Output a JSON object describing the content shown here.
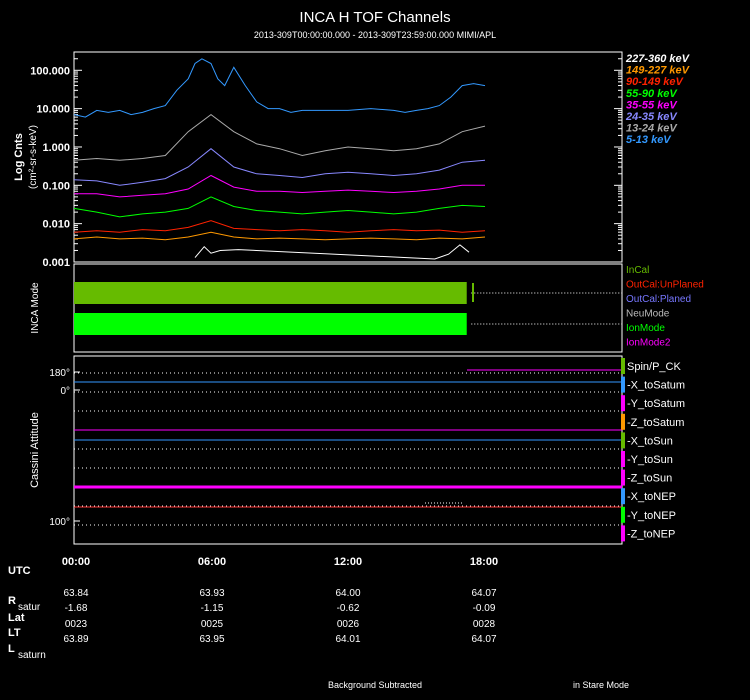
{
  "header": {
    "title": "INCA H TOF Channels",
    "subtitle": "2013-309T00:00:00.000 - 2013-309T23:59:00.000 MIMI/APL"
  },
  "footer": {
    "left": "Background Subtracted",
    "right": "in Stare Mode"
  },
  "ephemeris": {
    "label_utc": "UTC",
    "times": [
      "00:00",
      "06:00",
      "12:00",
      "18:00"
    ],
    "rows": [
      {
        "label": "R",
        "sub": "satur",
        "values": [
          "63.84",
          "63.93",
          "64.00",
          "64.07"
        ]
      },
      {
        "label": "Lat",
        "sub": "",
        "values": [
          "-1.68",
          "-1.15",
          "-0.62",
          "-0.09"
        ]
      },
      {
        "label": "LT",
        "sub": "",
        "values": [
          "0023",
          "0025",
          "0026",
          "0028"
        ]
      },
      {
        "label": "L",
        "sub": "saturn",
        "values": [
          "63.89",
          "63.95",
          "64.01",
          "64.07"
        ]
      }
    ]
  },
  "colors": {
    "axis": "#ffffff",
    "grid": "#ffffff"
  },
  "chart_data": [
    {
      "type": "line",
      "panel": "tof",
      "ylabel": "Log Cnts",
      "ylabel2": "(cm²-sr-s-keV)",
      "yscale": "log",
      "ylim": [
        0.001,
        300
      ],
      "xlim": [
        0,
        24
      ],
      "yticks": [
        "100.000",
        "10.000",
        "1.000",
        "0.100",
        "0.010",
        "0.001"
      ],
      "xticks": [
        0,
        6,
        12,
        18
      ],
      "legend_position": "right",
      "series": [
        {
          "name": "227-360 keV",
          "color": "#ffffff",
          "x": [
            5.3,
            5.7,
            6.0,
            6.4,
            7.2,
            15.8,
            16.4,
            16.9,
            17.3
          ],
          "y": [
            0.0013,
            0.0025,
            0.0017,
            0.002,
            0.0021,
            0.0012,
            0.0016,
            0.0028,
            0.0018
          ]
        },
        {
          "name": "149-227 keV",
          "color": "#ff9900",
          "x": [
            0,
            1,
            2,
            3,
            4,
            5,
            6,
            7,
            8,
            9,
            10,
            11,
            12,
            13,
            14,
            15,
            16,
            17,
            18
          ],
          "y": [
            0.004,
            0.0045,
            0.004,
            0.0042,
            0.0038,
            0.0045,
            0.006,
            0.0045,
            0.004,
            0.0042,
            0.004,
            0.0038,
            0.004,
            0.0042,
            0.004,
            0.0038,
            0.0042,
            0.004,
            0.0045
          ]
        },
        {
          "name": "90-149 keV",
          "color": "#ff2200",
          "x": [
            0,
            1,
            2,
            3,
            4,
            5,
            6,
            7,
            8,
            9,
            10,
            11,
            12,
            13,
            14,
            15,
            16,
            17,
            18
          ],
          "y": [
            0.006,
            0.0065,
            0.006,
            0.007,
            0.0065,
            0.008,
            0.012,
            0.0075,
            0.007,
            0.0065,
            0.007,
            0.0065,
            0.006,
            0.0065,
            0.007,
            0.0065,
            0.0068,
            0.006,
            0.0065
          ]
        },
        {
          "name": "55-90 keV",
          "color": "#00ff00",
          "x": [
            0,
            1,
            2,
            3,
            4,
            5,
            6,
            7,
            8,
            9,
            10,
            11,
            12,
            13,
            14,
            15,
            16,
            17,
            18
          ],
          "y": [
            0.025,
            0.02,
            0.015,
            0.018,
            0.02,
            0.025,
            0.05,
            0.028,
            0.022,
            0.02,
            0.018,
            0.02,
            0.022,
            0.02,
            0.018,
            0.02,
            0.025,
            0.03,
            0.028
          ]
        },
        {
          "name": "35-55 keV",
          "color": "#ff00ff",
          "x": [
            0,
            1,
            2,
            3,
            4,
            5,
            6,
            7,
            8,
            9,
            10,
            11,
            12,
            13,
            14,
            15,
            16,
            17,
            18
          ],
          "y": [
            0.06,
            0.06,
            0.05,
            0.055,
            0.06,
            0.08,
            0.18,
            0.09,
            0.07,
            0.07,
            0.065,
            0.07,
            0.075,
            0.07,
            0.065,
            0.07,
            0.08,
            0.1,
            0.1
          ]
        },
        {
          "name": "24-35 keV",
          "color": "#8888ff",
          "x": [
            0,
            1,
            2,
            3,
            4,
            5,
            6,
            7,
            8,
            9,
            10,
            11,
            12,
            13,
            14,
            15,
            16,
            17,
            18
          ],
          "y": [
            0.14,
            0.13,
            0.1,
            0.12,
            0.15,
            0.3,
            0.9,
            0.3,
            0.2,
            0.18,
            0.16,
            0.2,
            0.22,
            0.2,
            0.18,
            0.2,
            0.25,
            0.4,
            0.45
          ]
        },
        {
          "name": "13-24 keV",
          "color": "#aaaaaa",
          "x": [
            0,
            1,
            2,
            3,
            4,
            5,
            6,
            7,
            8,
            9,
            10,
            11,
            12,
            13,
            14,
            15,
            16,
            17,
            18
          ],
          "y": [
            0.45,
            0.5,
            0.45,
            0.5,
            0.6,
            2.5,
            7,
            2.5,
            1.2,
            0.9,
            0.6,
            0.8,
            1.0,
            0.9,
            0.8,
            0.9,
            1.2,
            2.5,
            3.5
          ]
        },
        {
          "name": "5-13 keV",
          "color": "#3399ff",
          "x": [
            0,
            0.5,
            1,
            1.5,
            2,
            2.5,
            3,
            3.5,
            4,
            4.5,
            5,
            5.3,
            5.6,
            6,
            6.3,
            6.6,
            7,
            7.5,
            8,
            8.5,
            9,
            9.5,
            10,
            11,
            12,
            13,
            14,
            14.5,
            15,
            15.5,
            16,
            16.5,
            17,
            17.5,
            18
          ],
          "y": [
            7,
            6,
            9,
            8,
            9,
            7,
            8,
            10,
            12,
            30,
            60,
            150,
            200,
            150,
            60,
            40,
            120,
            40,
            15,
            10,
            10,
            8,
            9,
            9,
            9,
            10,
            9,
            8,
            9,
            10,
            12,
            20,
            40,
            45,
            40
          ]
        }
      ]
    },
    {
      "type": "bar",
      "panel": "inca-mode",
      "ylabel": "INCA Mode",
      "xlim": [
        0,
        24
      ],
      "legend_position": "right",
      "legend": [
        {
          "name": "InCal",
          "color": "#66bb00"
        },
        {
          "name": "OutCal:UnPlaned",
          "color": "#ff2200"
        },
        {
          "name": "OutCal:Planed",
          "color": "#7777ff"
        },
        {
          "name": "NeuMode",
          "color": "#bbbbbb"
        },
        {
          "name": "IonMode",
          "color": "#00ff00"
        },
        {
          "name": "IonMode2",
          "color": "#ff00ff"
        }
      ],
      "bars": [
        {
          "mode": "InCal",
          "color": "#66bb00",
          "start": 0,
          "end": 17.2,
          "level": "upper"
        },
        {
          "mode": "IonMode",
          "color": "#00ff00",
          "start": 0,
          "end": 17.2,
          "level": "lower"
        }
      ]
    },
    {
      "type": "line",
      "panel": "cassini-attitude",
      "ylabel": "Cassini Attitude",
      "xlim": [
        0,
        24
      ],
      "yticks": [
        "180°",
        "0°",
        "100°"
      ],
      "legend_position": "right",
      "series": [
        {
          "name": "Spin/P_CK",
          "color": "#ffffff"
        },
        {
          "name": "-X_toSatum",
          "color": "#3399ff"
        },
        {
          "name": "-Y_toSatum",
          "color": "#ffffff"
        },
        {
          "name": "-Z_toSatum",
          "color": "#ff00ff"
        },
        {
          "name": "-X_toSun",
          "color": "#3399ff"
        },
        {
          "name": "-Y_toSun",
          "color": "#ffffff"
        },
        {
          "name": "-Z_toSun",
          "color": "#ffffff"
        },
        {
          "name": "-X_toNEP",
          "color": "#ff00ff"
        },
        {
          "name": "-Y_toNEP",
          "color": "#ff3333"
        },
        {
          "name": "-Z_toNEP",
          "color": "#ffffff"
        }
      ]
    }
  ]
}
